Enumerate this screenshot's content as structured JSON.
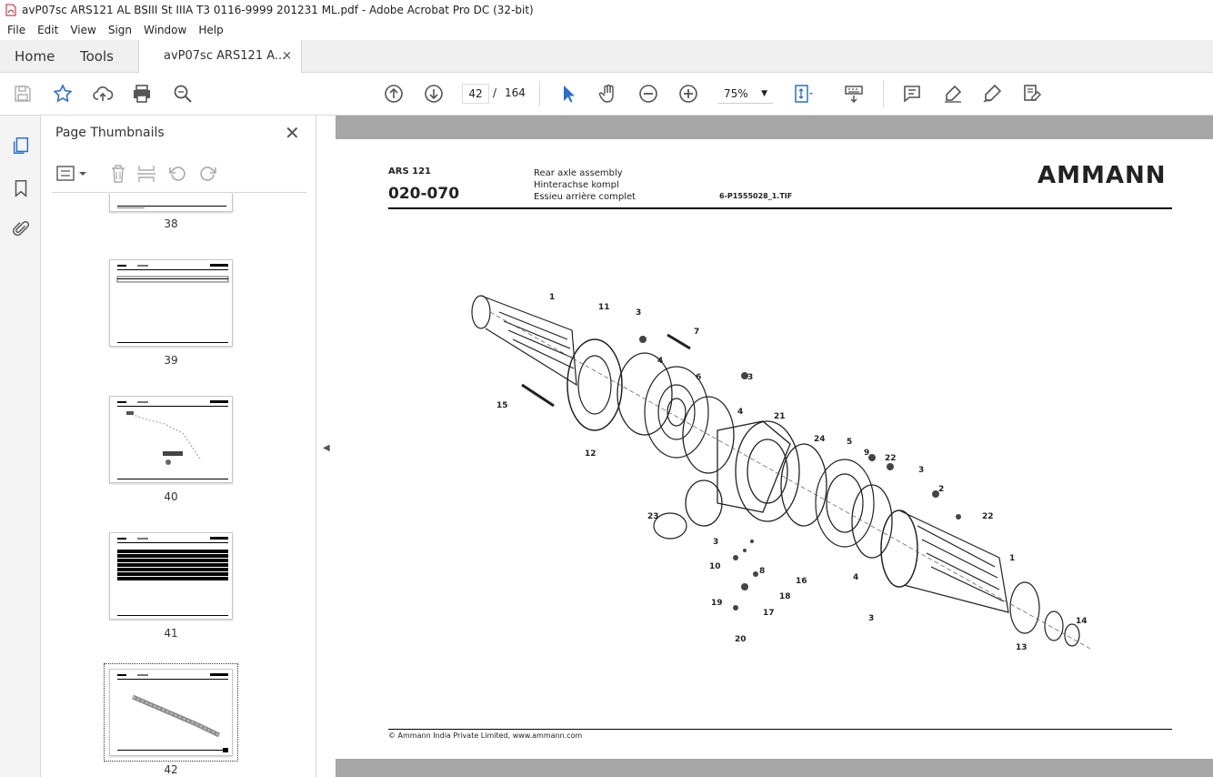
{
  "window": {
    "title": "avP07sc ARS121 AL BSIII St IIIA T3 0116-9999 201231 ML.pdf - Adobe Acrobat Pro DC (32-bit)"
  },
  "menu": [
    "File",
    "Edit",
    "View",
    "Sign",
    "Window",
    "Help"
  ],
  "tabs": {
    "home": "Home",
    "tools": "Tools",
    "document": "avP07sc ARS121 A...",
    "close": "×"
  },
  "toolbar": {
    "page_current": "42",
    "page_sep": "/",
    "page_total": "164",
    "zoom": "75%"
  },
  "thumbnails": {
    "title": "Page Thumbnails",
    "close": "✕",
    "pages": [
      "38",
      "39",
      "40",
      "41",
      "42"
    ]
  },
  "page": {
    "model": "ARS 121",
    "code": "020-070",
    "desc_en": "Rear axle assembly",
    "desc_de": "Hinterachse kompl",
    "desc_fr": "Essieu arrière complet",
    "file": "6-P1555028_1.TIF",
    "logo": "AMMANN",
    "footer": "© Ammann India Private Limited, www.ammann.com"
  },
  "callouts": [
    "1",
    "11",
    "3",
    "7",
    "4",
    "6",
    "3",
    "15",
    "12",
    "4",
    "21",
    "24",
    "5",
    "9",
    "22",
    "3",
    "2",
    "23",
    "3",
    "10",
    "8",
    "16",
    "18",
    "19",
    "17",
    "20",
    "4",
    "22",
    "1",
    "3",
    "14",
    "13"
  ]
}
